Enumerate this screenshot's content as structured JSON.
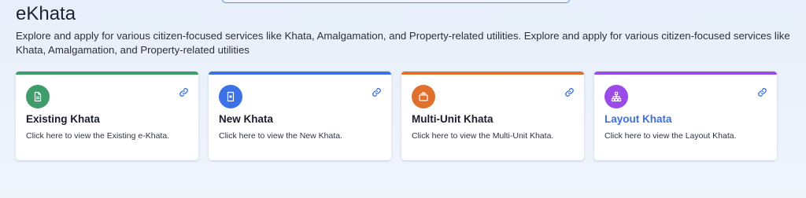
{
  "page": {
    "title": "eKhata",
    "description": "Explore and apply for various citizen-focused services like Khata, Amalgamation, and Property-related utilities. Explore and apply for various citizen-focused services like Khata, Amalgamation, and Property-related utilities"
  },
  "cards": [
    {
      "title": "Existing Khata",
      "description": "Click here to view the Existing e-Khata.",
      "icon": "document-icon",
      "accent_color": "#3f9d6b",
      "title_color": "#1a1e28"
    },
    {
      "title": "New Khata",
      "description": "Click here to view the New Khata.",
      "icon": "new-document-icon",
      "accent_color": "#3d72e6",
      "title_color": "#1a1e28"
    },
    {
      "title": "Multi-Unit Khata",
      "description": "Click here to view the Multi-Unit Khata.",
      "icon": "layers-icon",
      "accent_color": "#e0702e",
      "title_color": "#1a1e28"
    },
    {
      "title": "Layout Khata",
      "description": "Click here to view the Layout Khata.",
      "icon": "sitemap-icon",
      "accent_color": "#9b4be8",
      "title_color": "#3c6fe0"
    }
  ]
}
